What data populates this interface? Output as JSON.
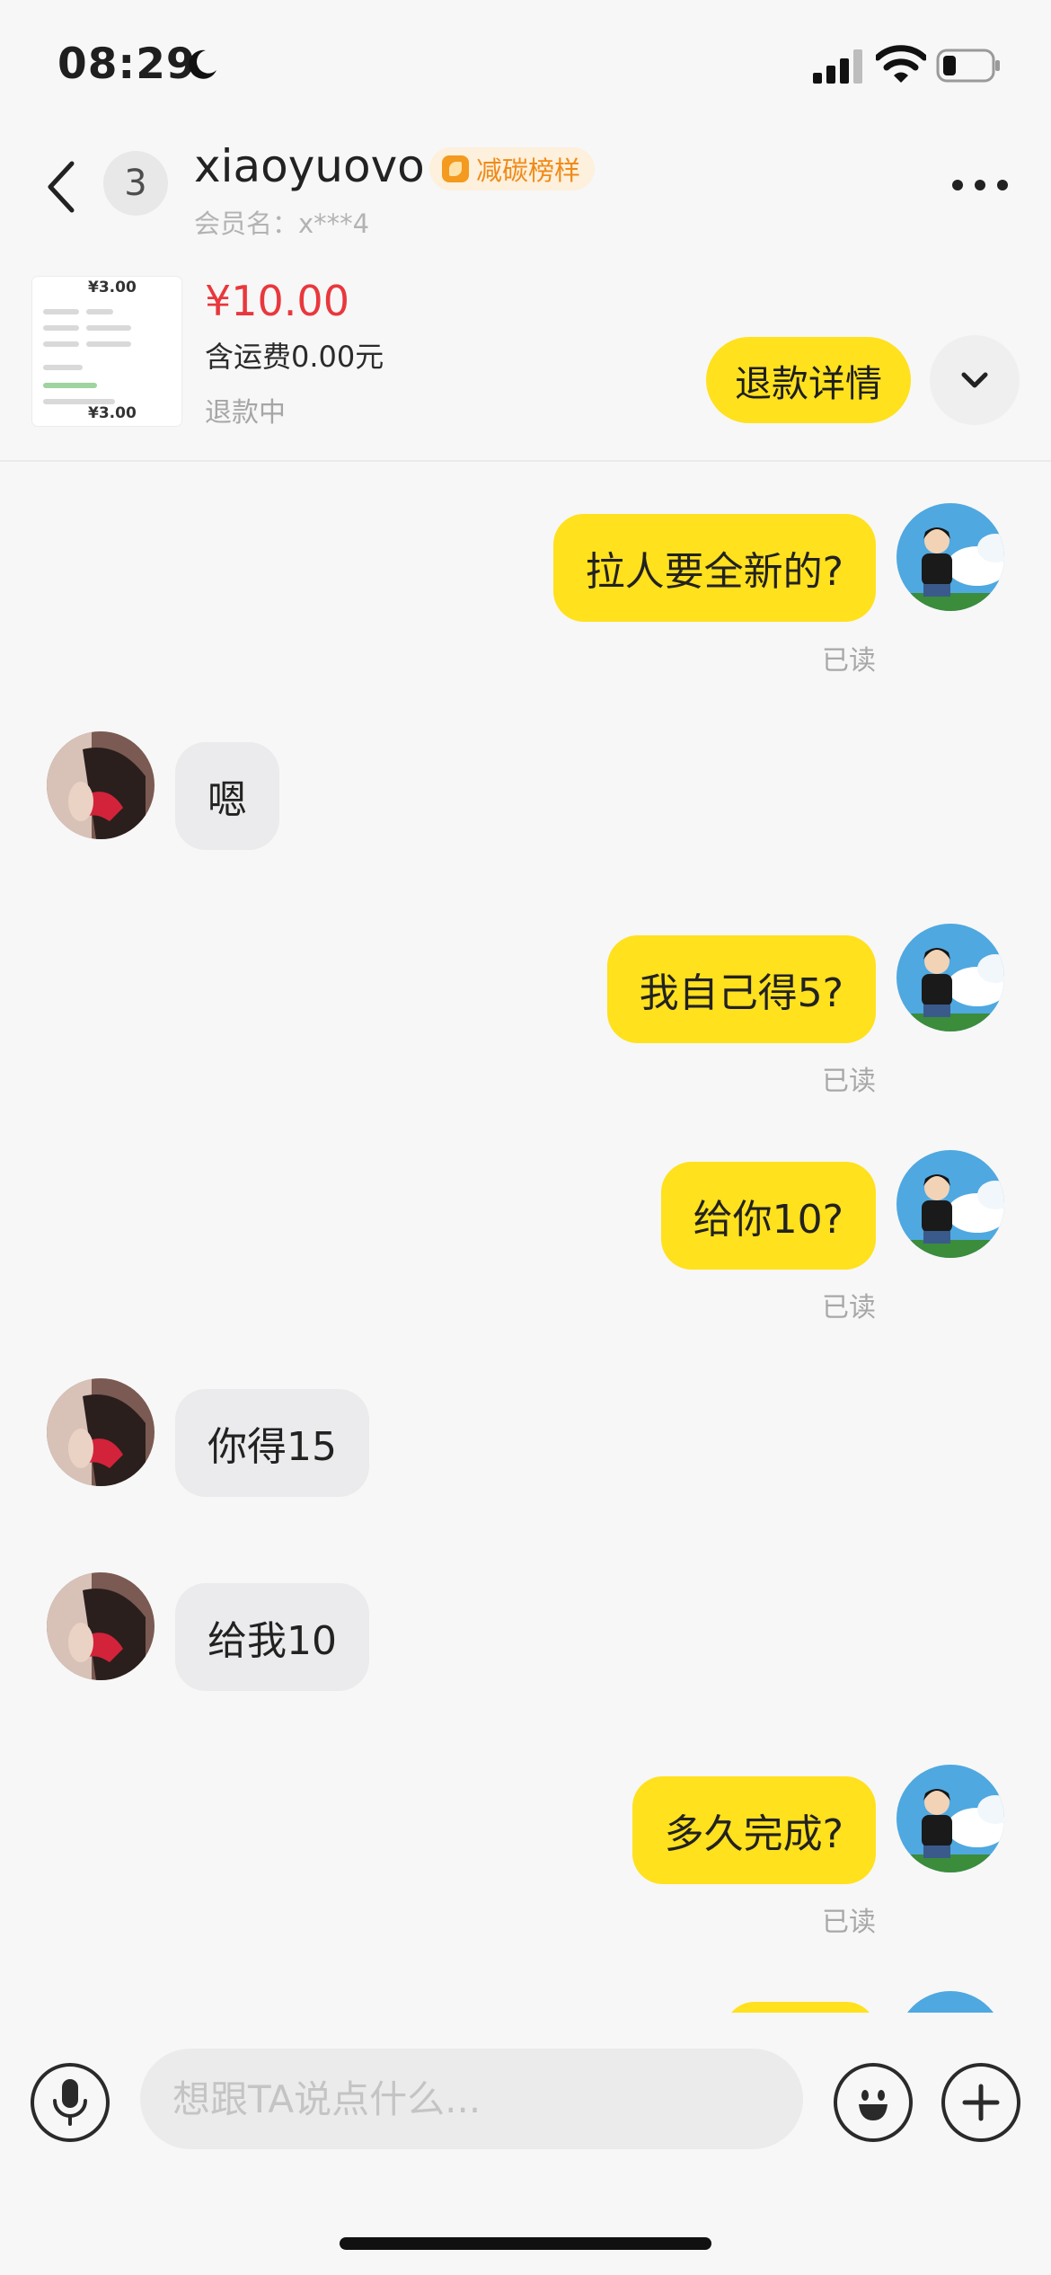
{
  "status_bar": {
    "time": "08:29"
  },
  "header": {
    "unread_count": "3",
    "nickname": "xiaoyuovo",
    "badge_label": "减碳榜样",
    "member_name": "会员名：x***4"
  },
  "order": {
    "price": "¥10.00",
    "shipping": "含运费0.00元",
    "status": "退款中",
    "refund_button": "退款详情",
    "thumb_price_top": "¥3.00",
    "thumb_price_bottom": "¥3.00"
  },
  "messages": [
    {
      "sender": "me",
      "text": "拉人要全新的?",
      "read": "已读"
    },
    {
      "sender": "other",
      "text": "嗯"
    },
    {
      "sender": "me",
      "text": "我自己得5?",
      "read": "已读"
    },
    {
      "sender": "me",
      "text": "给你10?",
      "read": "已读"
    },
    {
      "sender": "other",
      "text": "你得15"
    },
    {
      "sender": "other",
      "text": "给我10"
    },
    {
      "sender": "me",
      "text": "多久完成?",
      "read": "已读"
    }
  ],
  "input": {
    "placeholder": "想跟TA说点什么..."
  },
  "colors": {
    "accent": "#ffe11d",
    "price": "#e8383d",
    "badge": "#f08a18"
  },
  "icons": [
    "moon-icon",
    "signal-icon",
    "wifi-icon",
    "battery-icon",
    "back-arrow-icon",
    "more-icon",
    "chevron-down-icon",
    "microphone-icon",
    "emoji-icon",
    "plus-icon"
  ]
}
